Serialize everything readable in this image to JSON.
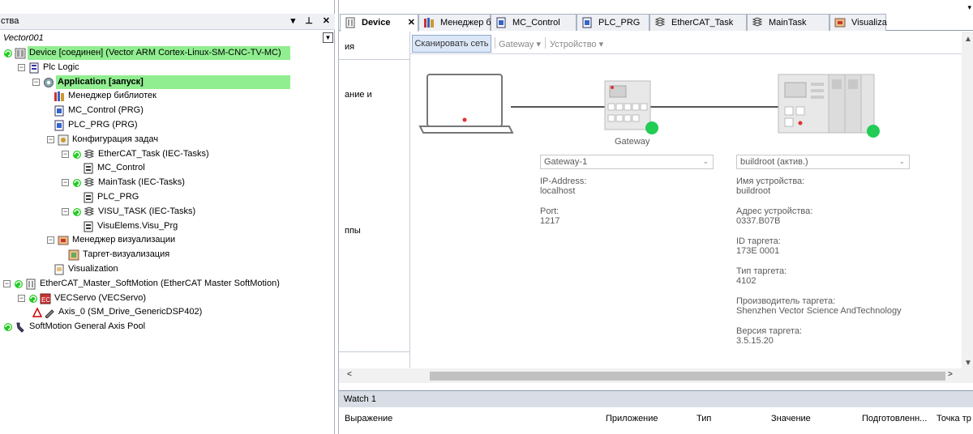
{
  "left_panel": {
    "title": "ства",
    "buttons": [
      "▾",
      "⊥",
      "✕"
    ],
    "project_name": "Vector001",
    "tree": [
      {
        "label": "Device [соединен] (Vector ARM Cortex-Linux-SM-CNC-TV-MC)",
        "level": 0,
        "highlight": true,
        "icon": "device-icon",
        "status": "connected-icon",
        "expander": "none"
      },
      {
        "label": "Plc Logic",
        "level": 1,
        "icon": "plc-logic-icon",
        "expander": "minus"
      },
      {
        "label": "Application [запуск]",
        "level": 2,
        "bold": true,
        "highlight": true,
        "icon": "application-gear-icon",
        "expander": "minus"
      },
      {
        "label": "Менеджер библиотек",
        "level": 3,
        "icon": "library-manager-icon"
      },
      {
        "label": "MC_Control (PRG)",
        "level": 3,
        "icon": "pou-icon"
      },
      {
        "label": "PLC_PRG (PRG)",
        "level": 3,
        "icon": "pou-icon"
      },
      {
        "label": "Конфигурация задач",
        "level": 3,
        "icon": "task-config-icon",
        "expander": "minus"
      },
      {
        "label": "EtherCAT_Task (IEC-Tasks)",
        "level": 4,
        "icon": "task-icon",
        "status": "running-icon",
        "expander": "minus"
      },
      {
        "label": "MC_Control",
        "level": 5,
        "icon": "program-call-icon"
      },
      {
        "label": "MainTask (IEC-Tasks)",
        "level": 4,
        "icon": "task-icon",
        "status": "running-icon",
        "expander": "minus"
      },
      {
        "label": "PLC_PRG",
        "level": 5,
        "icon": "program-call-icon"
      },
      {
        "label": "VISU_TASK (IEC-Tasks)",
        "level": 4,
        "icon": "task-icon",
        "status": "running-icon",
        "expander": "minus"
      },
      {
        "label": "VisuElems.Visu_Prg",
        "level": 5,
        "icon": "program-call-icon"
      },
      {
        "label": "Менеджер визуализации",
        "level": 3,
        "icon": "visu-manager-icon",
        "expander": "minus"
      },
      {
        "label": "Таргет-визуализация",
        "level": 4,
        "icon": "target-visu-icon"
      },
      {
        "label": "Visualization",
        "level": 3,
        "icon": "visualization-icon"
      },
      {
        "label": "EtherCAT_Master_SoftMotion (EtherCAT Master SoftMotion)",
        "level": 0,
        "icon": "ethercat-master-icon",
        "status": "running-icon",
        "expander": "minus"
      },
      {
        "label": "VECServo (VECServo)",
        "level": 1,
        "icon": "servo-icon",
        "status": "running-icon",
        "expander": "minus"
      },
      {
        "label": "Axis_0 (SM_Drive_GenericDSP402)",
        "level": 2,
        "icon": "axis-icon",
        "status": "warning-icon"
      },
      {
        "label": "SoftMotion General Axis Pool",
        "level": 0,
        "icon": "axis-pool-icon",
        "status": "running-icon"
      }
    ]
  },
  "tabs": [
    {
      "label": "Device",
      "active": true,
      "icon": "device-tab-icon"
    },
    {
      "label": "Менеджер библиотек",
      "icon": "library-tab-icon"
    },
    {
      "label": "MC_Control",
      "icon": "pou-tab-icon"
    },
    {
      "label": "PLC_PRG",
      "icon": "pou-tab-icon"
    },
    {
      "label": "EtherCAT_Task",
      "icon": "task-tab-icon"
    },
    {
      "label": "MainTask",
      "icon": "task-tab-icon"
    },
    {
      "label": "Visualiza",
      "icon": "visu-tab-icon"
    }
  ],
  "tab_close": "✕",
  "tab_overflow": "▾",
  "device_editor": {
    "side_items": [
      "ия",
      "ание и",
      "ппы"
    ],
    "toolbar": {
      "scan_label": "Сканировать сеть",
      "gateway_label": "Gateway",
      "device_label": "Устройство",
      "drop_glyph": "▾"
    },
    "gateway": {
      "caption": "Gateway",
      "select_value": "Gateway-1",
      "ip_label": "IP-Address:",
      "ip_value": "localhost",
      "port_label": "Port:",
      "port_value": "1217"
    },
    "device": {
      "select_value": "buildroot (актив.)",
      "fields": [
        {
          "label": "Имя устройства:",
          "value": "buildroot"
        },
        {
          "label": "Адрес устройства:",
          "value": "0337.B07B"
        },
        {
          "label": "ID таргета:",
          "value": "173E 0001"
        },
        {
          "label": "Тип таргета:",
          "value": "4102"
        },
        {
          "label": "Производитель таргета:",
          "value": "Shenzhen Vector Science AndTechnology"
        },
        {
          "label": "Версия таргета:",
          "value": "3.5.15.20"
        }
      ]
    },
    "status_color": "#22cc55",
    "select_caret": "⌄"
  },
  "scroll": {
    "left": "<",
    "right": ">",
    "up": "▲",
    "down": "▼"
  },
  "watch": {
    "title": "Watch 1",
    "columns": [
      "Выражение",
      "Приложение",
      "Тип",
      "Значение",
      "Подготовленн...",
      "Точка тр"
    ]
  }
}
